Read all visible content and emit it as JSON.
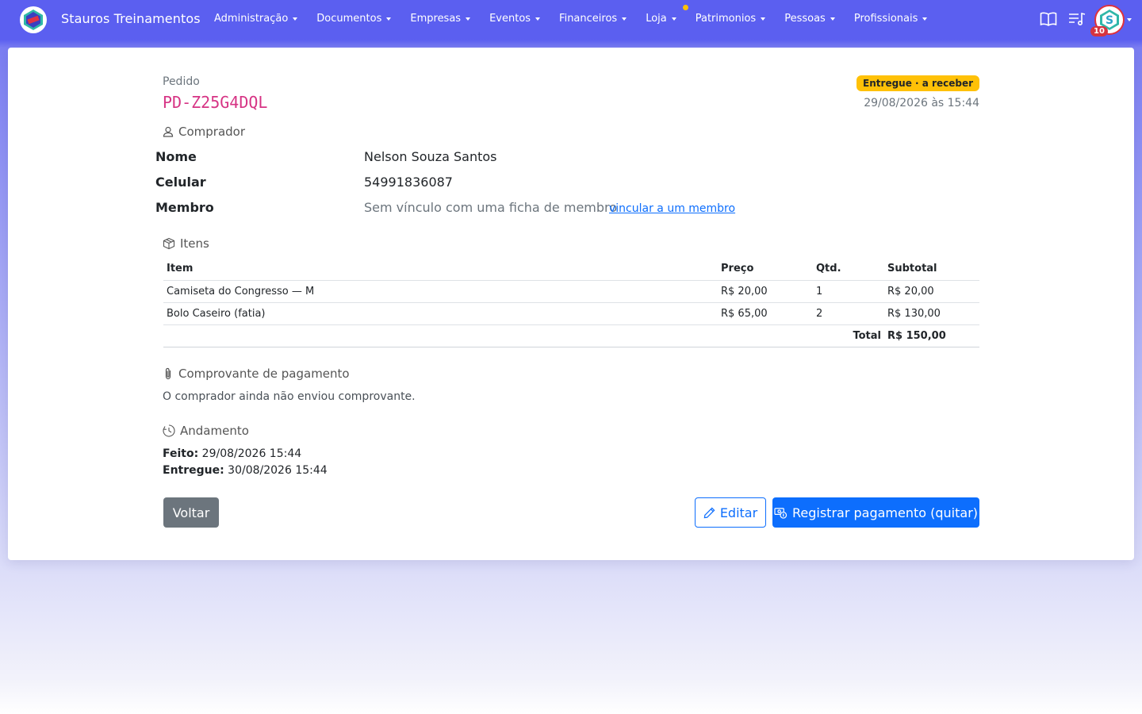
{
  "app": {
    "title": "Stauros Treinamentos"
  },
  "nav": {
    "items": [
      {
        "label": "Administração"
      },
      {
        "label": "Documentos"
      },
      {
        "label": "Empresas"
      },
      {
        "label": "Eventos"
      },
      {
        "label": "Financeiros"
      },
      {
        "label": "Loja"
      },
      {
        "label": "Patrimonios"
      },
      {
        "label": "Pessoas"
      },
      {
        "label": "Profissionais"
      }
    ],
    "avatar_badge": "10"
  },
  "order": {
    "label": "Pedido",
    "code": "PD-Z25G4DQL",
    "status": "Entregue · a receber",
    "date": "29/08/2026 às 15:44"
  },
  "buyer": {
    "title": "Comprador",
    "name_label": "Nome",
    "name": "Nelson Souza Santos",
    "phone_label": "Celular",
    "phone": "54991836087",
    "member_label": "Membro",
    "member_value": "Sem vínculo com uma ficha de membro",
    "member_link": "vincular a um membro"
  },
  "items": {
    "title": "Itens",
    "headers": [
      "Item",
      "Preço",
      "Qtd.",
      "Subtotal"
    ],
    "rows": [
      {
        "item": "Camiseta do Congresso — M",
        "price": "R$ 20,00",
        "qty": "1",
        "subtotal": "R$ 20,00"
      },
      {
        "item": "Bolo Caseiro (fatia)",
        "price": "R$ 65,00",
        "qty": "2",
        "subtotal": "R$ 130,00"
      }
    ],
    "total_label": "Total",
    "total": "R$ 150,00"
  },
  "receipt": {
    "title": "Comprovante de pagamento",
    "text": "O comprador ainda não enviou comprovante."
  },
  "progress": {
    "title": "Andamento",
    "made_label": "Feito:",
    "made": "29/08/2026 15:44",
    "delivered_label": "Entregue:",
    "delivered": "30/08/2026 15:44"
  },
  "actions": {
    "back": "Voltar",
    "edit": "Editar",
    "pay": "Registrar pagamento (quitar)"
  },
  "colors": {
    "navbar": "#5b5ff0",
    "code": "#d63384",
    "status": "#ffc107",
    "primary": "#0d6efd",
    "secondary": "#6c757d"
  }
}
